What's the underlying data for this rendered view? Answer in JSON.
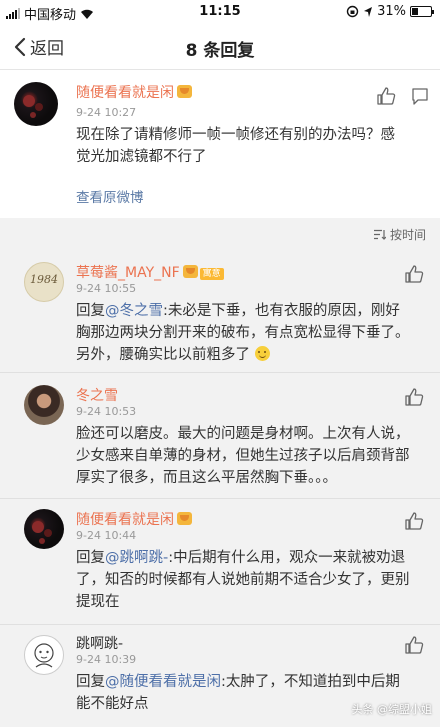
{
  "status_bar": {
    "carrier": "中国移动",
    "time": "11:15",
    "battery": "31%",
    "battery_level": 0.31
  },
  "nav": {
    "back_label": "返回",
    "title": "8 条回复"
  },
  "main_post": {
    "user": "随便看看就是闲",
    "time": "9-24 10:27",
    "text_line1": "现在除了请精修师一帧一帧修还有别的办法吗？感",
    "text_line2": "觉光加滤镜都不行了",
    "view_original": "查看原微博"
  },
  "sort_label": "按时间",
  "comments": [
    {
      "user": "草莓酱_MAY_NF",
      "badge": "寓意",
      "avatar_text": "1984",
      "time": "9-24 10:55",
      "prefix": "回复",
      "mention": "@冬之雪",
      "line1_rest": ":未必是下垂，也有衣服的原因，刚好",
      "line2": "胸那边两块分割开来的破布，有点宽松显得下垂了。",
      "line3": "另外，腰确实比以前粗多了"
    },
    {
      "user": "冬之雪",
      "time": "9-24 10:53",
      "line1": "脸还可以磨皮。最大的问题是身材啊。上次有人说，",
      "line2": "少女感来自单薄的身材，但她生过孩子以后肩颈背部",
      "line3": "厚实了很多，而且这么平居然胸下垂。。。"
    },
    {
      "user": "随便看看就是闲",
      "time": "9-24 10:44",
      "prefix": "回复",
      "mention": "@跳啊跳-",
      "line1_rest": ":中后期有什么用，观众一来就被劝退",
      "line2": "了，知否的时候都有人说她前期不适合少女了，更别",
      "line3": "提现在"
    },
    {
      "user": "跳啊跳-",
      "time": "9-24 10:39",
      "prefix": "回复",
      "mention": "@随便看看就是闲",
      "line1_rest": ":太肿了，不知道拍到中后期",
      "line2": "能不能好点"
    }
  ],
  "watermark": "头条 @综盟小姐"
}
